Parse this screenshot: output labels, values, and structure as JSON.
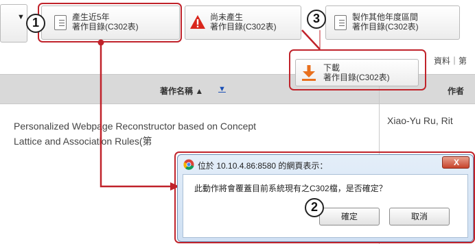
{
  "toolbar": {
    "generate_recent": {
      "line1": "產生近5年",
      "line2": "著作目錄(C302表)"
    },
    "not_generated": {
      "line1": "尚未產生",
      "line2": "著作目錄(C302表)"
    },
    "other_years": {
      "line1": "製作其他年度區間",
      "line2": "著作目錄(C302表)"
    },
    "right_text": "資料｜第"
  },
  "download": {
    "line1": "下載",
    "line2": "著作目錄(C302表)"
  },
  "table": {
    "col_title": "著作名稱 ▲",
    "col_title_sort": "▼",
    "col_author": "作者",
    "row1_title_line1": "Personalized Webpage Reconstructor based on Concept",
    "row1_title_line2": "Lattice and Association Rules(第",
    "row1_author": "Xiao-Yu Ru, Rit"
  },
  "dialog": {
    "title": "位於 10.10.4.86:8580 的網頁表示：",
    "close_label": "X",
    "message": "此動作將會覆蓋目前系統現有之C302檔，是否確定？",
    "ok_label": "確定",
    "cancel_label": "取消"
  },
  "callouts": {
    "n1": "1",
    "n2": "2",
    "n3": "3"
  },
  "colors": {
    "callout_red": "#c0222a",
    "warning_red": "#d9261c",
    "download_orange": "#e8701e"
  }
}
